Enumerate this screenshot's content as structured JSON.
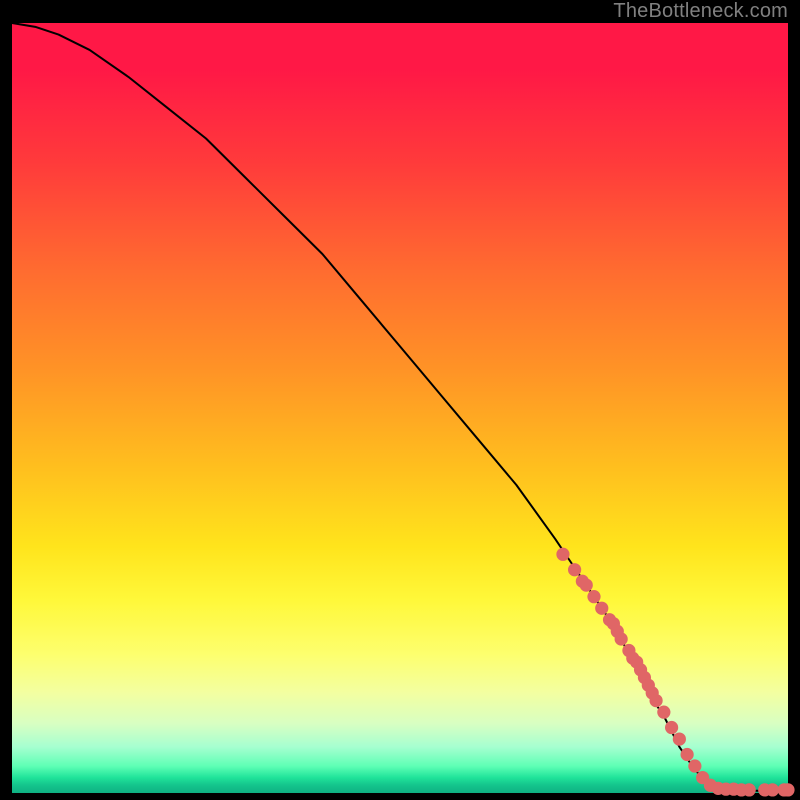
{
  "header": {
    "attribution": "TheBottleneck.com"
  },
  "chart_data": {
    "type": "line",
    "title": "",
    "xlabel": "",
    "ylabel": "",
    "xlim": [
      0,
      100
    ],
    "ylim": [
      0,
      100
    ],
    "grid": false,
    "legend": false,
    "series": [
      {
        "name": "curve",
        "style": "line",
        "color": "#000000",
        "x": [
          0,
          3,
          6,
          10,
          15,
          20,
          25,
          30,
          35,
          40,
          45,
          50,
          55,
          60,
          65,
          70,
          72,
          74,
          76,
          78,
          80,
          82,
          84,
          86,
          88,
          90,
          92,
          94,
          96,
          98,
          100
        ],
        "y": [
          100,
          99.5,
          98.5,
          96.5,
          93,
          89,
          85,
          80,
          75,
          70,
          64,
          58,
          52,
          46,
          40,
          33,
          30,
          27,
          24,
          21,
          17,
          13,
          10,
          6,
          3,
          1,
          0.5,
          0.3,
          0.3,
          0.3,
          0.3
        ]
      },
      {
        "name": "markers",
        "style": "scatter",
        "color": "#e06666",
        "x": [
          71,
          72.5,
          73.5,
          74,
          75,
          76,
          77,
          77.5,
          78,
          78.5,
          79.5,
          80,
          80.5,
          81,
          81.5,
          82,
          82.5,
          83,
          84,
          85,
          86,
          87,
          88,
          89,
          90,
          91,
          92,
          93,
          94,
          95,
          97,
          98,
          99.5,
          100
        ],
        "y": [
          31,
          29,
          27.5,
          27,
          25.5,
          24,
          22.5,
          22,
          21,
          20,
          18.5,
          17.5,
          17,
          16,
          15,
          14,
          13,
          12,
          10.5,
          8.5,
          7,
          5,
          3.5,
          2,
          1,
          0.6,
          0.5,
          0.5,
          0.4,
          0.4,
          0.4,
          0.4,
          0.4,
          0.4
        ]
      }
    ]
  },
  "colors": {
    "marker": "#e06666",
    "curve": "#000000",
    "header": "#808080"
  }
}
